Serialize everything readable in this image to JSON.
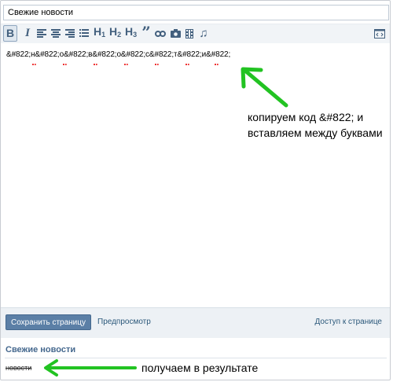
{
  "page_title_input": {
    "value": "Свежие новости"
  },
  "toolbar": {
    "buttons": [
      {
        "icon": "bold-icon",
        "label": "B"
      },
      {
        "icon": "italic-icon",
        "label": "I"
      },
      {
        "icon": "align-left-icon"
      },
      {
        "icon": "align-center-icon"
      },
      {
        "icon": "align-right-icon"
      },
      {
        "icon": "list-icon"
      },
      {
        "icon": "heading1-icon",
        "label": "H",
        "sub": "1"
      },
      {
        "icon": "heading2-icon",
        "label": "H",
        "sub": "2"
      },
      {
        "icon": "heading3-icon",
        "label": "H",
        "sub": "3"
      },
      {
        "icon": "quote-icon",
        "label": "”"
      },
      {
        "icon": "link-icon"
      },
      {
        "icon": "camera-icon"
      },
      {
        "icon": "video-icon"
      },
      {
        "icon": "audio-icon",
        "label": "♫"
      },
      {
        "icon": "wiki-markup-toggle-icon"
      }
    ]
  },
  "editor": {
    "content": "&#822;н&#822;о&#822;в&#822;о&#822;с&#822;т&#822;и&#822;"
  },
  "annotation_top": "копируем код &#822; и вставляем между буквами",
  "footer": {
    "save_label": "Сохранить страницу",
    "preview_label": "Предпросмотр",
    "access_label": "Доступ к странице"
  },
  "result": {
    "title": "Свежие новости",
    "text": "новости",
    "annotation": "получаем в результате"
  },
  "colors": {
    "accent": "#45688e",
    "button": "#5b7fa6",
    "arrow": "#22c322",
    "spellcheck": "#e33333"
  }
}
